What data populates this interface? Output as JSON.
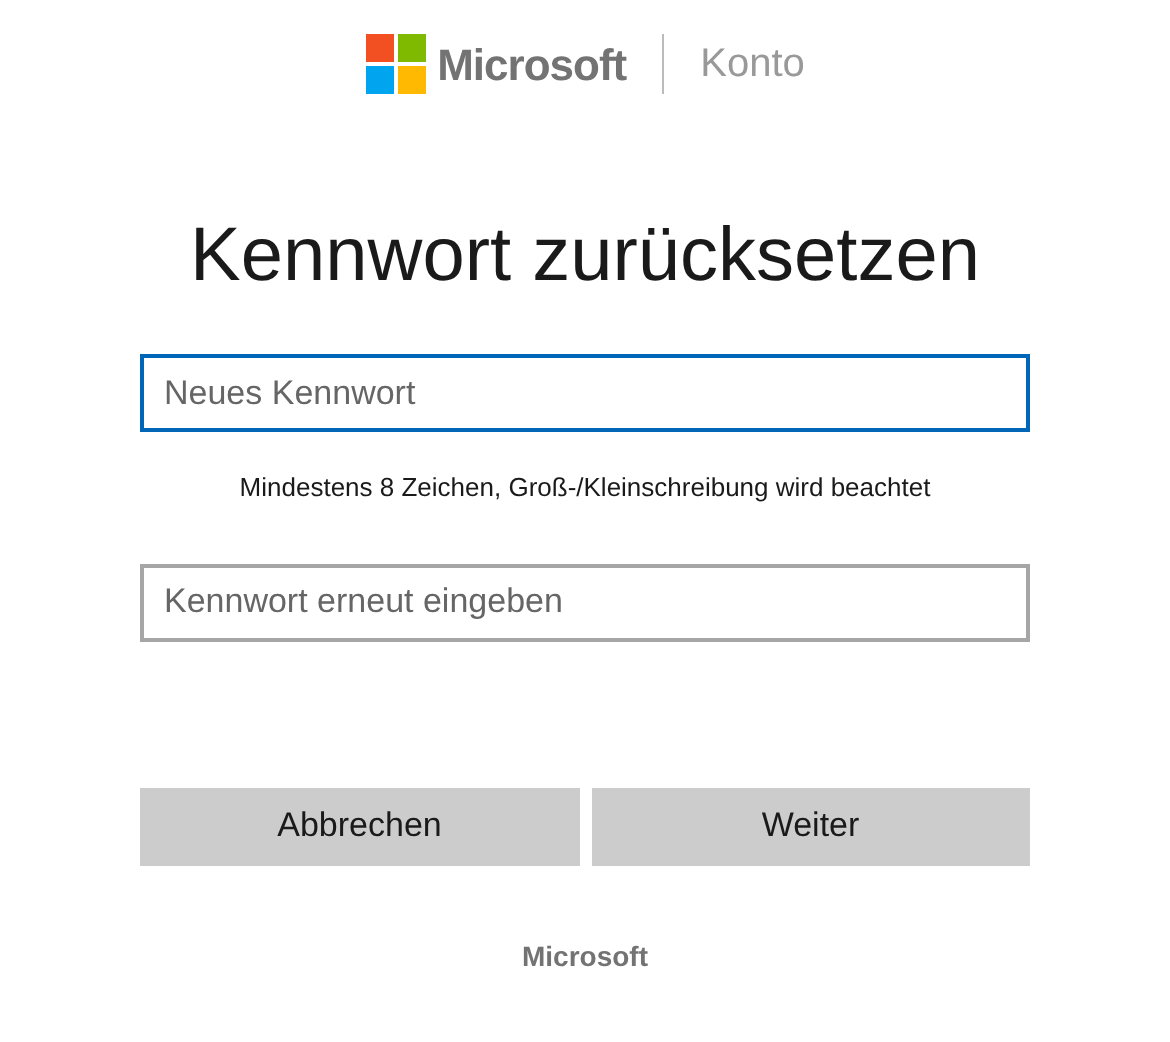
{
  "header": {
    "brand": "Microsoft",
    "section": "Konto"
  },
  "title": "Kennwort zurücksetzen",
  "fields": [
    {
      "placeholder": "Neues Kennwort",
      "focused": true,
      "hint": "Mindestens 8 Zeichen, Groß-/Kleinschreibung wird beachtet"
    },
    {
      "placeholder": "Kennwort erneut eingeben",
      "focused": false
    }
  ],
  "buttons": [
    "Abbrechen",
    "Weiter"
  ],
  "footer": "Microsoft"
}
